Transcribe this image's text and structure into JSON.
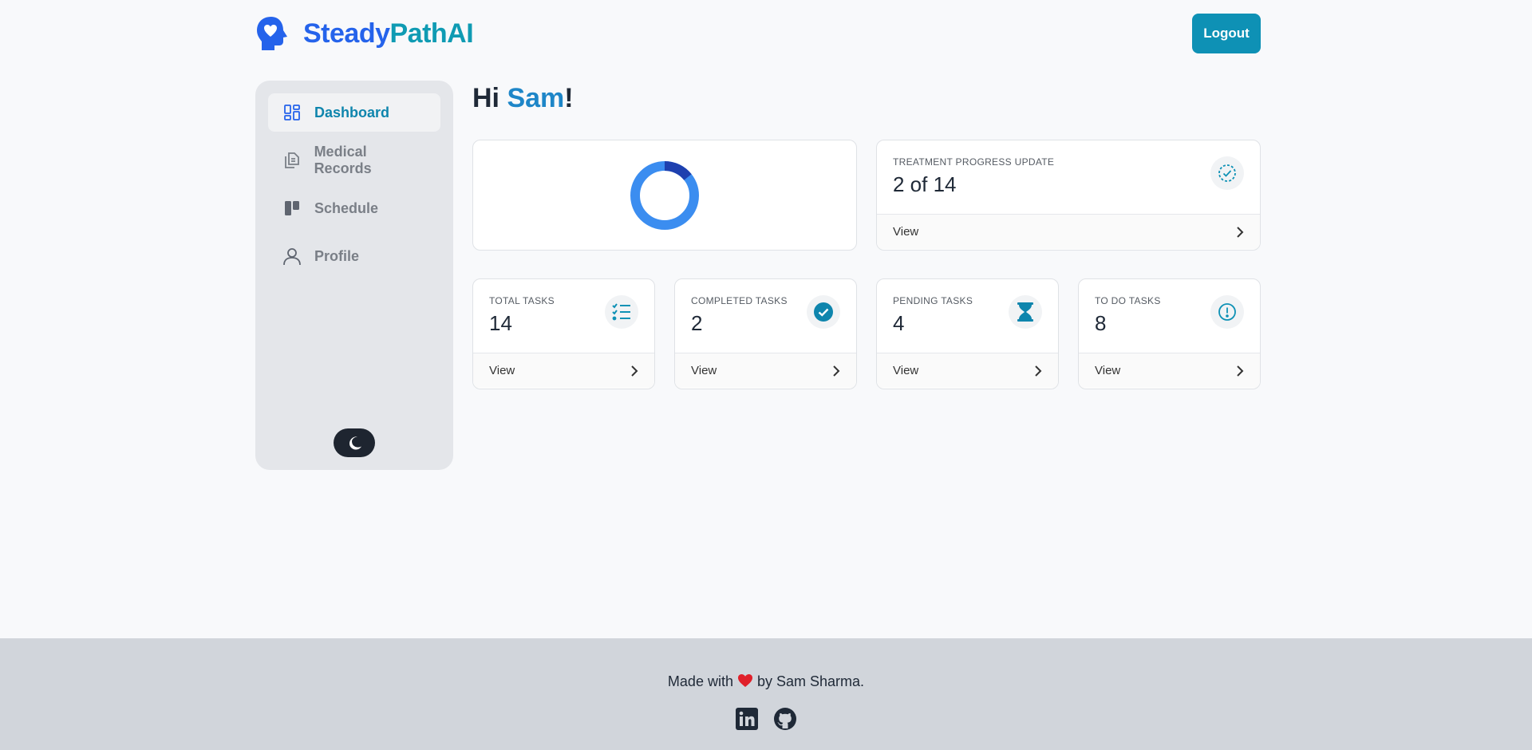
{
  "brand": {
    "name_part1": "Steady",
    "name_part2": "PathAI",
    "logo_icon": "head-heart-icon"
  },
  "header": {
    "logout_label": "Logout"
  },
  "sidebar": {
    "items": [
      {
        "label": "Dashboard",
        "icon": "dashboard-icon",
        "active": true
      },
      {
        "label": "Medical Records",
        "icon": "documents-icon",
        "active": false
      },
      {
        "label": "Schedule",
        "icon": "kanban-icon",
        "active": false
      },
      {
        "label": "Profile",
        "icon": "user-icon",
        "active": false
      }
    ],
    "theme_toggle_icon": "moon-icon"
  },
  "greeting": {
    "prefix": "Hi ",
    "name": "Sam",
    "suffix": "!"
  },
  "progress_chart": {
    "completed": 2,
    "total": 14,
    "colors": {
      "completed": "#1e40af",
      "remaining": "#3b8df0"
    }
  },
  "progress_card": {
    "title": "TREATMENT PROGRESS UPDATE",
    "value": "2 of 14",
    "icon": "dashed-check-circle-icon",
    "link": "View"
  },
  "stats": [
    {
      "title": "TOTAL TASKS",
      "value": "14",
      "icon": "list-check-icon",
      "link": "View"
    },
    {
      "title": "COMPLETED TASKS",
      "value": "2",
      "icon": "check-circle-icon",
      "link": "View"
    },
    {
      "title": "PENDING TASKS",
      "value": "4",
      "icon": "hourglass-icon",
      "link": "View"
    },
    {
      "title": "TO DO TASKS",
      "value": "8",
      "icon": "exclamation-circle-icon",
      "link": "View"
    }
  ],
  "footer": {
    "text_before": "Made with",
    "text_after": "by Sam Sharma.",
    "heart_icon": "heart-icon",
    "links": [
      "linkedin-icon",
      "github-icon"
    ]
  },
  "colors": {
    "accent": "#0e91b5",
    "brand_blue": "#2563eb",
    "brand_teal": "#0f9bb3"
  }
}
